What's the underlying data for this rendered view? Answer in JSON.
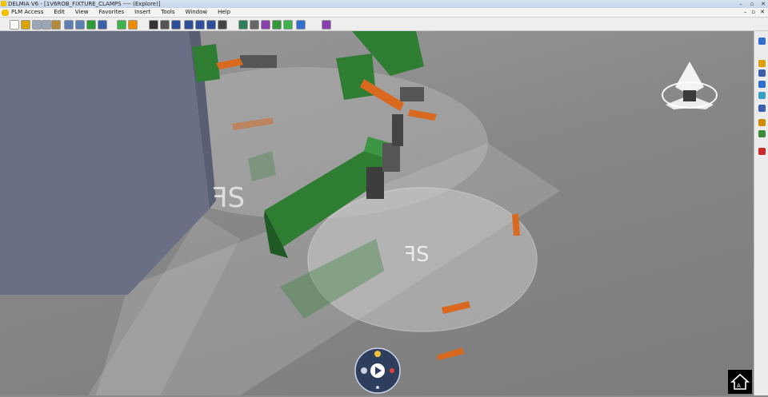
{
  "window": {
    "title": "DELMIA V6 - [1V6ROB_FIXTURE_CLAMPS ---- (Explore)]",
    "controls": {
      "minimize": "–",
      "restore": "▫",
      "close": "✕"
    }
  },
  "menubar": {
    "items": [
      "PLM Access",
      "Edit",
      "View",
      "Favorites",
      "Insert",
      "Tools",
      "Window",
      "Help"
    ],
    "right_controls": {
      "minimize": "–",
      "restore": "▫",
      "close": "✕"
    }
  },
  "toolbar": {
    "icons": [
      {
        "name": "new-icon",
        "color": "#ffffff"
      },
      {
        "name": "open-icon",
        "color": "#d9a300"
      },
      {
        "name": "cut-icon",
        "color": "#9aa7b8"
      },
      {
        "name": "copy-icon",
        "color": "#9aa7b8"
      },
      {
        "name": "paste-icon",
        "color": "#b48a3a"
      },
      {
        "name": "undo-icon",
        "color": "#5b7fb5"
      },
      {
        "name": "redo-icon",
        "color": "#5b7fb5"
      },
      {
        "name": "update-icon",
        "color": "#2e9a3a"
      },
      {
        "name": "help-icon",
        "color": "#3a5fa8"
      },
      {
        "name": "fit-all-icon",
        "color": "#3cb34a"
      },
      {
        "name": "orbit-icon",
        "color": "#f08a00"
      },
      {
        "name": "render-icon",
        "color": "#333333"
      },
      {
        "name": "zoom-area-icon",
        "color": "#555555"
      },
      {
        "name": "walk-icon",
        "color": "#2e4e9a"
      },
      {
        "name": "fly-icon",
        "color": "#2e4e9a"
      },
      {
        "name": "pan-icon",
        "color": "#2e4e9a"
      },
      {
        "name": "zoom-icon",
        "color": "#2e4e9a"
      },
      {
        "name": "shading-icon",
        "color": "#444444"
      },
      {
        "name": "shading-edges-icon",
        "color": "#2f7d5a"
      },
      {
        "name": "wireframe-icon",
        "color": "#666666"
      },
      {
        "name": "hide-show-icon",
        "color": "#8a3fb0"
      },
      {
        "name": "swap-icon",
        "color": "#2e9a3a"
      },
      {
        "name": "measure-icon",
        "color": "#3cb34a"
      },
      {
        "name": "user-icon",
        "color": "#2e6fd0"
      },
      {
        "name": "settings-icon",
        "color": "#8a3fb0"
      }
    ]
  },
  "rightbar": {
    "icons": [
      {
        "name": "select-icon",
        "color": "#2e6fd0"
      },
      {
        "name": "edit-icon",
        "color": "#e0a000"
      },
      {
        "name": "filter-icon",
        "color": "#3a5fa8"
      },
      {
        "name": "tree-icon",
        "color": "#2e6fd0"
      },
      {
        "name": "layers-icon",
        "color": "#3aa0c8"
      },
      {
        "name": "capture-icon",
        "color": "#3a5fa8"
      },
      {
        "name": "lock-icon",
        "color": "#d08a00"
      },
      {
        "name": "publish-icon",
        "color": "#3a8a3a"
      },
      {
        "name": "delete-icon",
        "color": "#cc2a2a"
      }
    ]
  },
  "viewport": {
    "accent_green": "#2e7d32",
    "accent_orange": "#d9691e"
  }
}
